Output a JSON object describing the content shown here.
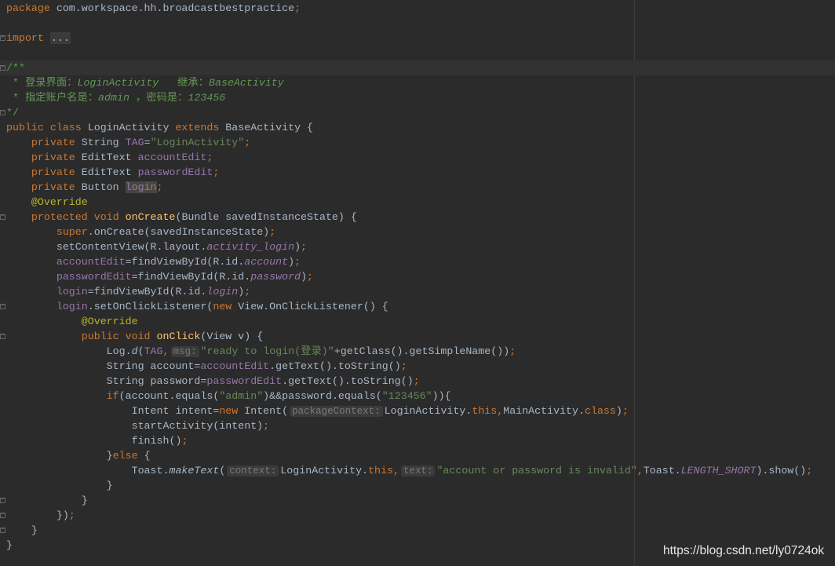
{
  "colors": {
    "background": "#2b2b2b",
    "keyword": "#cc7832",
    "string": "#6a8759",
    "field": "#9876aa",
    "method": "#ffc66d",
    "annotation": "#bbb529",
    "doc_comment": "#629755",
    "text": "#a9b7c6"
  },
  "current_line": 4,
  "code": {
    "lines": [
      {
        "tokens": [
          [
            "k",
            "package "
          ],
          [
            "p",
            "com.workspace.hh.broadcastbestpractice"
          ],
          [
            "k",
            ";"
          ]
        ]
      },
      {
        "tokens": []
      },
      {
        "tokens": [
          [
            "k",
            "import "
          ],
          [
            "fold-ph",
            "..."
          ]
        ],
        "fold": "+"
      },
      {
        "tokens": []
      },
      {
        "tokens": [
          [
            "c",
            "/**"
          ]
        ],
        "fold": "-"
      },
      {
        "tokens": [
          [
            "c",
            " * 登录界面："
          ],
          [
            "ci",
            "LoginActivity"
          ],
          [
            "c",
            "   继承："
          ],
          [
            "ci",
            "BaseActivity"
          ]
        ]
      },
      {
        "tokens": [
          [
            "c",
            " * 指定账户名是："
          ],
          [
            "ci",
            "admin"
          ],
          [
            "c",
            " ，密码是："
          ],
          [
            "ci",
            "123456"
          ]
        ]
      },
      {
        "tokens": [
          [
            "c",
            "*/"
          ]
        ],
        "fold": "-"
      },
      {
        "tokens": [
          [
            "k",
            "public class "
          ],
          [
            "p",
            "LoginActivity "
          ],
          [
            "k",
            "extends "
          ],
          [
            "p",
            "BaseActivity {"
          ]
        ]
      },
      {
        "tokens": [
          [
            "p",
            "    "
          ],
          [
            "k",
            "private "
          ],
          [
            "p",
            "String "
          ],
          [
            "f",
            "TAG"
          ],
          [
            "p",
            "="
          ],
          [
            "s",
            "\"LoginActivity\""
          ],
          [
            "k",
            ";"
          ]
        ]
      },
      {
        "tokens": [
          [
            "p",
            "    "
          ],
          [
            "k",
            "private "
          ],
          [
            "p",
            "EditText "
          ],
          [
            "f",
            "accountEdit"
          ],
          [
            "k",
            ";"
          ]
        ]
      },
      {
        "tokens": [
          [
            "p",
            "    "
          ],
          [
            "k",
            "private "
          ],
          [
            "p",
            "EditText "
          ],
          [
            "f",
            "passwordEdit"
          ],
          [
            "k",
            ";"
          ]
        ]
      },
      {
        "tokens": [
          [
            "p",
            "    "
          ],
          [
            "k",
            "private "
          ],
          [
            "p",
            "Button "
          ],
          [
            "sel",
            "login"
          ],
          [
            "k",
            ";"
          ]
        ]
      },
      {
        "tokens": [
          [
            "p",
            "    "
          ],
          [
            "a",
            "@Override"
          ]
        ]
      },
      {
        "tokens": [
          [
            "p",
            "    "
          ],
          [
            "k",
            "protected void "
          ],
          [
            "m",
            "onCreate"
          ],
          [
            "p",
            "(Bundle savedInstanceState) {"
          ]
        ],
        "fold": "-"
      },
      {
        "tokens": [
          [
            "p",
            "        "
          ],
          [
            "k",
            "super"
          ],
          [
            "p",
            ".onCreate(savedInstanceState)"
          ],
          [
            "k",
            ";"
          ]
        ]
      },
      {
        "tokens": [
          [
            "p",
            "        setContentView(R.layout."
          ],
          [
            "fi",
            "activity_login"
          ],
          [
            "p",
            ")"
          ],
          [
            "k",
            ";"
          ]
        ]
      },
      {
        "tokens": [
          [
            "p",
            "        "
          ],
          [
            "f",
            "accountEdit"
          ],
          [
            "p",
            "=findViewById(R.id."
          ],
          [
            "fi",
            "account"
          ],
          [
            "p",
            ")"
          ],
          [
            "k",
            ";"
          ]
        ]
      },
      {
        "tokens": [
          [
            "p",
            "        "
          ],
          [
            "f",
            "passwordEdit"
          ],
          [
            "p",
            "=findViewById(R.id."
          ],
          [
            "fi",
            "password"
          ],
          [
            "p",
            ")"
          ],
          [
            "k",
            ";"
          ]
        ]
      },
      {
        "tokens": [
          [
            "p",
            "        "
          ],
          [
            "f",
            "login"
          ],
          [
            "p",
            "=findViewById(R.id."
          ],
          [
            "fi",
            "login"
          ],
          [
            "p",
            ")"
          ],
          [
            "k",
            ";"
          ]
        ]
      },
      {
        "tokens": [
          [
            "p",
            "        "
          ],
          [
            "f",
            "login"
          ],
          [
            "p",
            ".setOnClickListener("
          ],
          [
            "k",
            "new "
          ],
          [
            "p",
            "View.OnClickListener() {"
          ]
        ],
        "fold": "-"
      },
      {
        "tokens": [
          [
            "p",
            "            "
          ],
          [
            "a",
            "@Override"
          ]
        ]
      },
      {
        "tokens": [
          [
            "p",
            "            "
          ],
          [
            "k",
            "public void "
          ],
          [
            "m",
            "onClick"
          ],
          [
            "p",
            "(View v) {"
          ]
        ],
        "fold": "-"
      },
      {
        "tokens": [
          [
            "p",
            "                Log."
          ],
          [
            "i",
            "d"
          ],
          [
            "p",
            "("
          ],
          [
            "f",
            "TAG"
          ],
          [
            "k",
            ","
          ],
          [
            "h",
            "msg:"
          ],
          [
            "s",
            "\"ready to login(登录)\""
          ],
          [
            "p",
            "+getClass().getSimpleName())"
          ],
          [
            "k",
            ";"
          ]
        ]
      },
      {
        "tokens": [
          [
            "p",
            "                String account="
          ],
          [
            "f",
            "accountEdit"
          ],
          [
            "p",
            ".getText().toString()"
          ],
          [
            "k",
            ";"
          ]
        ]
      },
      {
        "tokens": [
          [
            "p",
            "                String password="
          ],
          [
            "f",
            "passwordEdit"
          ],
          [
            "p",
            ".getText().toString()"
          ],
          [
            "k",
            ";"
          ]
        ]
      },
      {
        "tokens": [
          [
            "p",
            "                "
          ],
          [
            "k",
            "if"
          ],
          [
            "p",
            "(account.equals("
          ],
          [
            "s",
            "\"admin\""
          ],
          [
            "p",
            ")&&password.equals("
          ],
          [
            "s",
            "\"123456\""
          ],
          [
            "p",
            ")){"
          ]
        ]
      },
      {
        "tokens": [
          [
            "p",
            "                    Intent intent="
          ],
          [
            "k",
            "new "
          ],
          [
            "p",
            "Intent("
          ],
          [
            "h",
            "packageContext:"
          ],
          [
            "p",
            "LoginActivity."
          ],
          [
            "k",
            "this,"
          ],
          [
            "p",
            "MainActivity."
          ],
          [
            "k",
            "class"
          ],
          [
            "p",
            ")"
          ],
          [
            "k",
            ";"
          ]
        ]
      },
      {
        "tokens": [
          [
            "p",
            "                    startActivity(intent)"
          ],
          [
            "k",
            ";"
          ]
        ]
      },
      {
        "tokens": [
          [
            "p",
            "                    finish()"
          ],
          [
            "k",
            ";"
          ]
        ]
      },
      {
        "tokens": [
          [
            "p",
            "                }"
          ],
          [
            "k",
            "else "
          ],
          [
            "p",
            "{"
          ]
        ]
      },
      {
        "tokens": [
          [
            "p",
            "                    Toast."
          ],
          [
            "i",
            "makeText"
          ],
          [
            "p",
            "("
          ],
          [
            "h",
            "context:"
          ],
          [
            "p",
            "LoginActivity."
          ],
          [
            "k",
            "this,"
          ],
          [
            "h",
            "text:"
          ],
          [
            "s",
            "\"account or password is invalid\""
          ],
          [
            "k",
            ","
          ],
          [
            "p",
            "Toast."
          ],
          [
            "fi",
            "LENGTH_SHORT"
          ],
          [
            "p",
            ").show()"
          ],
          [
            "k",
            ";"
          ]
        ]
      },
      {
        "tokens": [
          [
            "p",
            "                }"
          ]
        ]
      },
      {
        "tokens": [
          [
            "p",
            "            }"
          ]
        ],
        "fold": "-"
      },
      {
        "tokens": [
          [
            "p",
            "        })"
          ],
          [
            "k",
            ";"
          ]
        ],
        "fold": "-"
      },
      {
        "tokens": [
          [
            "p",
            "    }"
          ]
        ],
        "fold": "-"
      },
      {
        "tokens": [
          [
            "p",
            "}"
          ]
        ]
      }
    ]
  },
  "watermark": "https://blog.csdn.net/ly0724ok"
}
